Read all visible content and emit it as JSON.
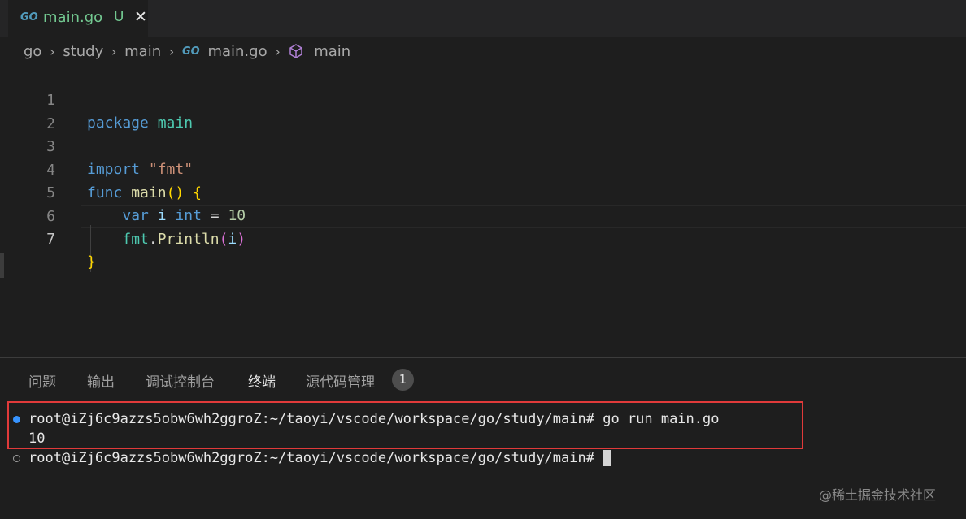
{
  "tab": {
    "badge": "GO",
    "filename": "main.go",
    "status": "U",
    "close": "✕"
  },
  "breadcrumb": {
    "items": [
      "go",
      "study",
      "main"
    ],
    "file_badge": "GO",
    "file": "main.go",
    "symbol": "main",
    "separator": "›"
  },
  "editor": {
    "lines": [
      {
        "num": "1"
      },
      {
        "num": "2"
      },
      {
        "num": "3"
      },
      {
        "num": "4"
      },
      {
        "num": "5"
      },
      {
        "num": "6"
      },
      {
        "num": "7"
      }
    ],
    "tokens": {
      "package": "package",
      "main_pkg": "main",
      "import": "import",
      "import_path": "\"fmt\"",
      "func": "func",
      "func_name": "main",
      "parens": "()",
      "open_brace": "{",
      "var": "var",
      "i": "i",
      "int": "int",
      "eq": "=",
      "ten": "10",
      "fmt": "fmt",
      "dot": ".",
      "println": "Println",
      "lparen": "(",
      "arg": "i",
      "rparen": ")",
      "close_brace": "}"
    }
  },
  "panel": {
    "tabs": [
      "问题",
      "输出",
      "调试控制台",
      "终端",
      "源代码管理"
    ],
    "active_tab": "终端",
    "scm_count": "1"
  },
  "terminal": {
    "line1": "root@iZj6c9azzs5obw6wh2ggroZ:~/taoyi/vscode/workspace/go/study/main# go run main.go",
    "line2": "10",
    "line3": "root@iZj6c9azzs5obw6wh2ggroZ:~/taoyi/vscode/workspace/go/study/main# "
  },
  "watermark": "@稀土掘金技术社区",
  "colors": {
    "go_blue": "#519aba",
    "untracked_green": "#73c991",
    "highlight_red": "#e03a3a",
    "terminal_dot_blue": "#3794ff"
  }
}
